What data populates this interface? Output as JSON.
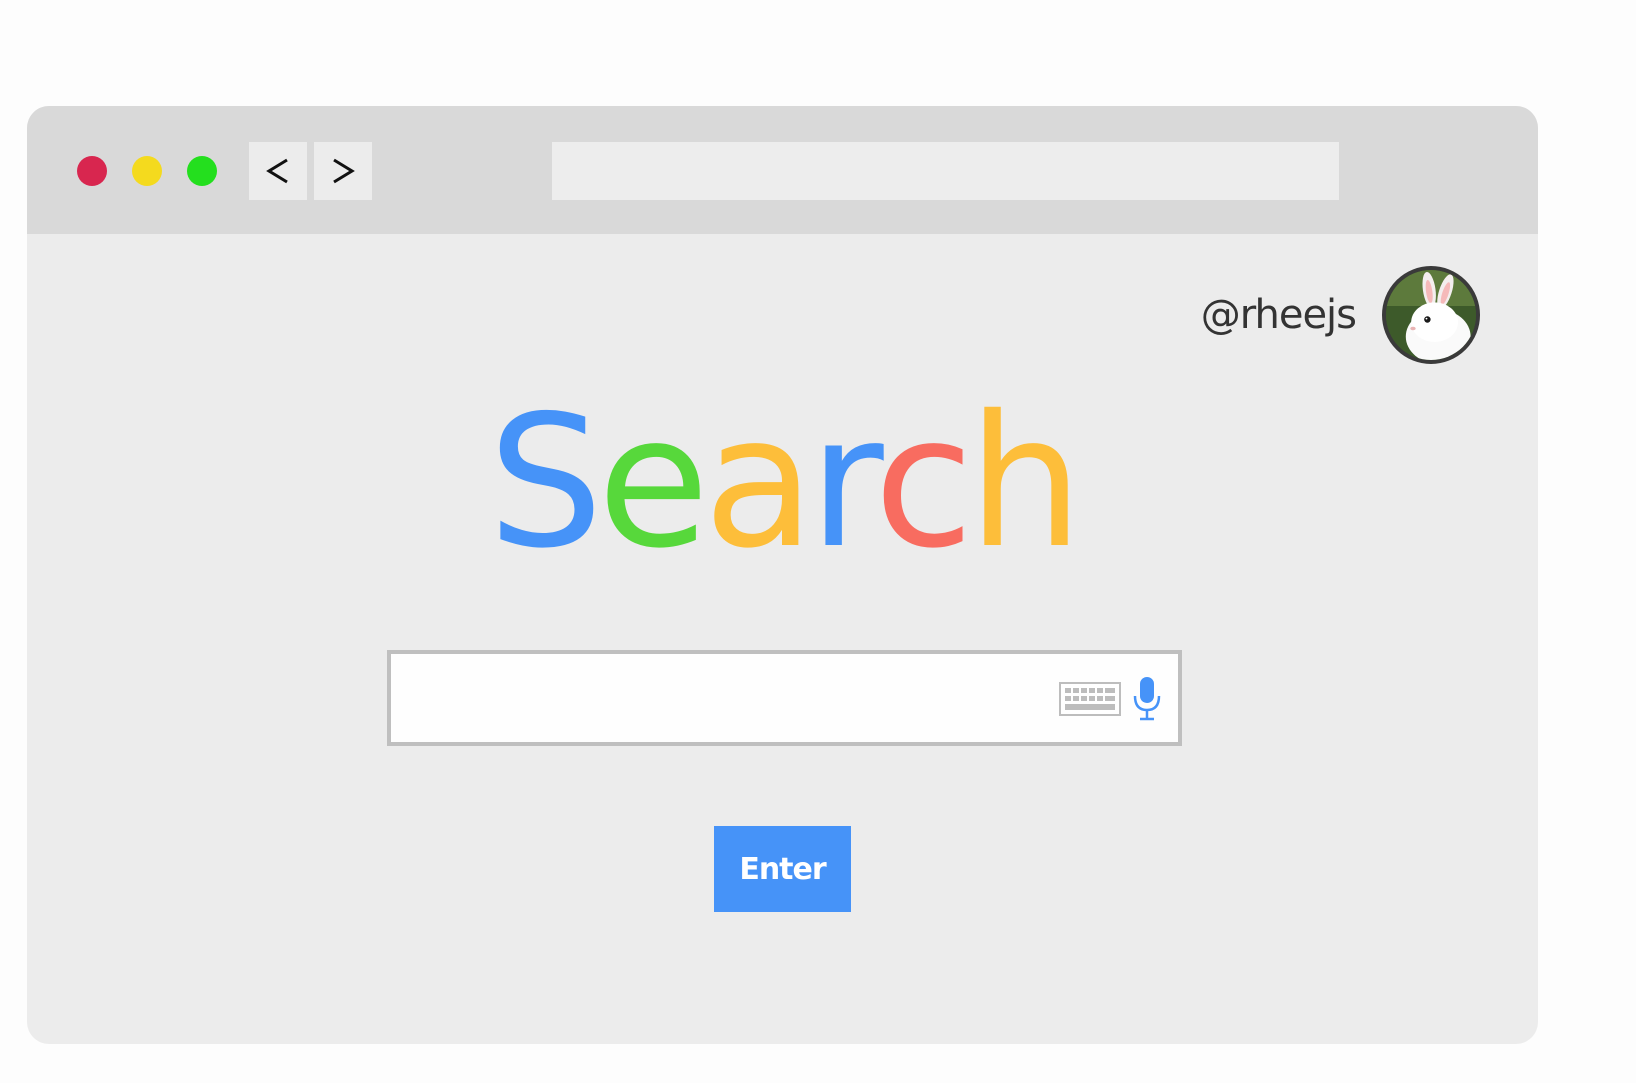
{
  "window": {
    "controls": [
      {
        "name": "close",
        "color": "#d8264f"
      },
      {
        "name": "minimize",
        "color": "#f4da1e"
      },
      {
        "name": "maximize",
        "color": "#24df1e"
      }
    ],
    "back_icon": "chevron-left-icon",
    "forward_icon": "chevron-right-icon",
    "address_value": ""
  },
  "user": {
    "handle": "@rheejs",
    "avatar_icon": "rabbit-avatar"
  },
  "logo": {
    "letters": [
      {
        "char": "S",
        "color": "#4693f8"
      },
      {
        "char": "e",
        "color": "#57d83b"
      },
      {
        "char": "a",
        "color": "#fdbe3a"
      },
      {
        "char": "r",
        "color": "#4693f8"
      },
      {
        "char": "c",
        "color": "#f86c60"
      },
      {
        "char": "h",
        "color": "#fdbe3a"
      }
    ]
  },
  "search": {
    "value": "",
    "placeholder": "",
    "keyboard_icon": "keyboard-icon",
    "mic_icon": "microphone-icon"
  },
  "enter_button": {
    "label": "Enter",
    "color": "#4693f8"
  }
}
